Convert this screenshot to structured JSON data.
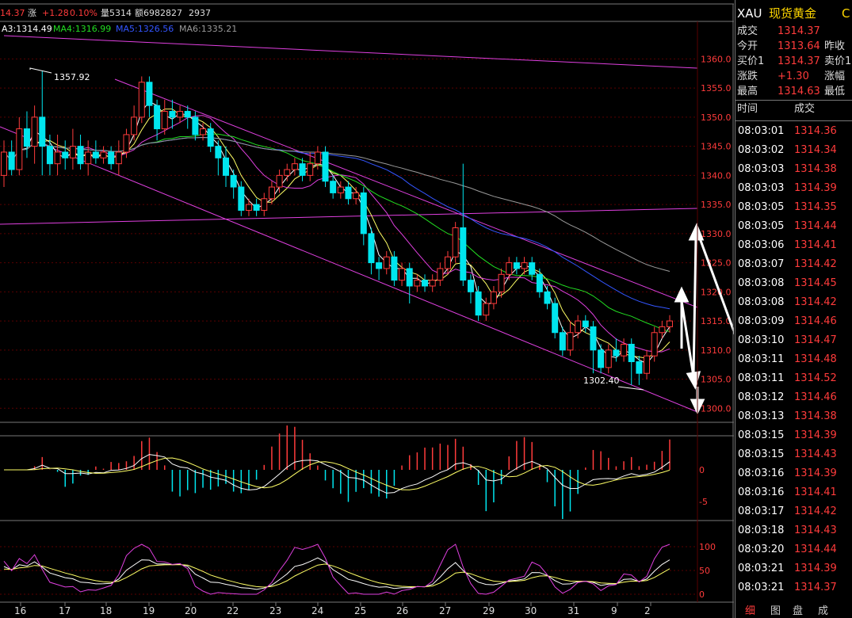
{
  "header": {
    "price": "14.37",
    "change_label": "涨",
    "change": "+1.28",
    "change_pct": "0.10%",
    "volume": "量5314",
    "amount": "额6982827",
    "extra": "2937"
  },
  "ma_legend": [
    {
      "label": "A3:1314.49",
      "color": "#ffffff"
    },
    {
      "label": "MA4:1316.99",
      "color": "#22dd22"
    },
    {
      "label": "MA5:1326.56",
      "color": "#3355ff"
    },
    {
      "label": "MA6:1335.21",
      "color": "#9a9a9a"
    }
  ],
  "annotations": {
    "high_label": "1357.92",
    "low_label": "1302.40"
  },
  "chart_data": {
    "type": "candlestick",
    "price_axis": {
      "ticks": [
        1360,
        1355,
        1350,
        1345,
        1340,
        1335,
        1330,
        1325,
        1320,
        1315,
        1310,
        1305,
        1300
      ],
      "labels": [
        "1360.0",
        "1355.0",
        "1350.0",
        "1345.0",
        "1340.0",
        "1335.0",
        "1330.0",
        "1325.0",
        "1320.0",
        "1315.0",
        "1310.0",
        "1305.0",
        "1300.0"
      ],
      "range": [
        1298,
        1364
      ]
    },
    "x_labels": [
      "16",
      "17",
      "18",
      "19",
      "20",
      "22",
      "23",
      "24",
      "25",
      "26",
      "27",
      "29",
      "30",
      "31",
      "9",
      "2"
    ],
    "candles": [
      [
        1340,
        1344,
        1338,
        1346
      ],
      [
        1344,
        1341,
        1340,
        1346
      ],
      [
        1341,
        1348,
        1340,
        1350
      ],
      [
        1348,
        1345,
        1343,
        1351
      ],
      [
        1345,
        1350,
        1342,
        1352
      ],
      [
        1350,
        1345,
        1340,
        1358
      ],
      [
        1345,
        1342,
        1340,
        1347
      ],
      [
        1342,
        1344,
        1340,
        1347
      ],
      [
        1344,
        1343,
        1341,
        1346
      ],
      [
        1343,
        1345,
        1341,
        1348
      ],
      [
        1345,
        1342,
        1341,
        1347
      ],
      [
        1342,
        1344,
        1340,
        1346
      ],
      [
        1344,
        1343,
        1342,
        1346
      ],
      [
        1343,
        1344,
        1342,
        1345
      ],
      [
        1344,
        1342,
        1341,
        1345
      ],
      [
        1342,
        1344,
        1340,
        1346
      ],
      [
        1344,
        1347,
        1343,
        1348
      ],
      [
        1347,
        1350,
        1346,
        1352
      ],
      [
        1350,
        1356,
        1349,
        1357
      ],
      [
        1356,
        1352,
        1350,
        1357
      ],
      [
        1352,
        1348,
        1346,
        1353
      ],
      [
        1348,
        1351,
        1347,
        1353
      ],
      [
        1351,
        1350,
        1348,
        1353
      ],
      [
        1350,
        1351,
        1349,
        1352
      ],
      [
        1351,
        1350,
        1348,
        1352
      ],
      [
        1350,
        1347,
        1346,
        1351
      ],
      [
        1347,
        1348,
        1346,
        1349
      ],
      [
        1348,
        1345,
        1344,
        1349
      ],
      [
        1345,
        1343,
        1340,
        1346
      ],
      [
        1343,
        1340,
        1338,
        1345
      ],
      [
        1340,
        1338,
        1336,
        1341
      ],
      [
        1338,
        1334,
        1333,
        1339
      ],
      [
        1334,
        1335,
        1333,
        1336
      ],
      [
        1335,
        1334,
        1333,
        1336
      ],
      [
        1334,
        1336,
        1333,
        1337
      ],
      [
        1336,
        1338,
        1335,
        1339
      ],
      [
        1338,
        1340,
        1337,
        1341
      ],
      [
        1340,
        1341,
        1339,
        1342
      ],
      [
        1341,
        1342,
        1340,
        1343
      ],
      [
        1342,
        1340,
        1339,
        1343
      ],
      [
        1340,
        1342,
        1339,
        1344
      ],
      [
        1342,
        1344,
        1341,
        1345
      ],
      [
        1344,
        1339,
        1338,
        1345
      ],
      [
        1339,
        1337,
        1336,
        1340
      ],
      [
        1337,
        1338,
        1336,
        1339
      ],
      [
        1338,
        1336,
        1335,
        1339
      ],
      [
        1336,
        1337,
        1335,
        1338
      ],
      [
        1337,
        1330,
        1328,
        1338
      ],
      [
        1330,
        1325,
        1323,
        1331
      ],
      [
        1325,
        1324,
        1322,
        1326
      ],
      [
        1324,
        1326,
        1323,
        1327
      ],
      [
        1326,
        1322,
        1321,
        1327
      ],
      [
        1322,
        1324,
        1321,
        1325
      ],
      [
        1324,
        1321,
        1318,
        1325
      ],
      [
        1321,
        1322,
        1320,
        1323
      ],
      [
        1322,
        1321,
        1320,
        1323
      ],
      [
        1321,
        1322,
        1320,
        1323
      ],
      [
        1322,
        1324,
        1321,
        1325
      ],
      [
        1324,
        1326,
        1323,
        1327
      ],
      [
        1326,
        1331,
        1325,
        1332
      ],
      [
        1331,
        1322,
        1321,
        1342
      ],
      [
        1322,
        1320,
        1318,
        1323
      ],
      [
        1320,
        1316,
        1315,
        1321
      ],
      [
        1316,
        1318,
        1315,
        1319
      ],
      [
        1318,
        1320,
        1317,
        1321
      ],
      [
        1320,
        1323,
        1319,
        1324
      ],
      [
        1323,
        1325,
        1322,
        1326
      ],
      [
        1325,
        1324,
        1323,
        1326
      ],
      [
        1324,
        1325,
        1323,
        1326
      ],
      [
        1325,
        1323,
        1322,
        1326
      ],
      [
        1323,
        1320,
        1319,
        1324
      ],
      [
        1320,
        1318,
        1317,
        1321
      ],
      [
        1318,
        1313,
        1312,
        1319
      ],
      [
        1313,
        1310,
        1309,
        1314
      ],
      [
        1310,
        1313,
        1309,
        1315
      ],
      [
        1313,
        1315,
        1312,
        1316
      ],
      [
        1315,
        1314,
        1313,
        1316
      ],
      [
        1314,
        1310,
        1306,
        1315
      ],
      [
        1310,
        1307,
        1306,
        1311
      ],
      [
        1307,
        1310,
        1306,
        1311
      ],
      [
        1310,
        1309,
        1308,
        1312
      ],
      [
        1309,
        1311,
        1308,
        1312
      ],
      [
        1311,
        1308,
        1304,
        1312
      ],
      [
        1308,
        1306,
        1304,
        1309
      ],
      [
        1306,
        1309,
        1305,
        1310
      ],
      [
        1309,
        1313,
        1308,
        1314
      ],
      [
        1313,
        1314,
        1312,
        1315
      ],
      [
        1314,
        1315,
        1313,
        1316
      ]
    ],
    "candle_format": [
      "open",
      "close",
      "low",
      "high"
    ],
    "macd_axis": {
      "ticks": [
        0,
        -5
      ],
      "labels": [
        "0",
        "-5"
      ]
    },
    "kdj_axis": {
      "ticks": [
        100,
        50,
        0
      ],
      "labels": [
        "100",
        "50",
        "0"
      ]
    }
  },
  "side": {
    "symbol": "XAU",
    "name": "现货黄金",
    "suffix": "C",
    "quote": [
      {
        "label": "成交",
        "value": "1314.37",
        "label2": ""
      },
      {
        "label": "今开",
        "value": "1313.64",
        "label2": "昨收"
      },
      {
        "label": "买价1",
        "value": "1314.37",
        "label2": "卖价1"
      },
      {
        "label": "涨跌",
        "value": "+1.30",
        "label2": "涨幅"
      },
      {
        "label": "最高",
        "value": "1314.63",
        "label2": "最低"
      }
    ],
    "ticks_header": {
      "time": "时间",
      "price": "成交"
    },
    "ticks": [
      {
        "time": "08:03:01",
        "price": "1314.36"
      },
      {
        "time": "08:03:02",
        "price": "1314.34"
      },
      {
        "time": "08:03:03",
        "price": "1314.38"
      },
      {
        "time": "08:03:03",
        "price": "1314.39"
      },
      {
        "time": "08:03:05",
        "price": "1314.35"
      },
      {
        "time": "08:03:05",
        "price": "1314.44"
      },
      {
        "time": "08:03:06",
        "price": "1314.41"
      },
      {
        "time": "08:03:07",
        "price": "1314.42"
      },
      {
        "time": "08:03:08",
        "price": "1314.45"
      },
      {
        "time": "08:03:08",
        "price": "1314.42"
      },
      {
        "time": "08:03:09",
        "price": "1314.46"
      },
      {
        "time": "08:03:10",
        "price": "1314.47"
      },
      {
        "time": "08:03:11",
        "price": "1314.48"
      },
      {
        "time": "08:03:11",
        "price": "1314.52"
      },
      {
        "time": "08:03:12",
        "price": "1314.46"
      },
      {
        "time": "08:03:13",
        "price": "1314.38"
      },
      {
        "time": "08:03:15",
        "price": "1314.39"
      },
      {
        "time": "08:03:15",
        "price": "1314.43"
      },
      {
        "time": "08:03:16",
        "price": "1314.39"
      },
      {
        "time": "08:03:16",
        "price": "1314.41"
      },
      {
        "time": "08:03:17",
        "price": "1314.42"
      },
      {
        "time": "08:03:18",
        "price": "1314.43"
      },
      {
        "time": "08:03:20",
        "price": "1314.44"
      },
      {
        "time": "08:03:21",
        "price": "1314.39"
      },
      {
        "time": "08:03:21",
        "price": "1314.37"
      }
    ],
    "tabs": [
      "细",
      "图",
      "盘",
      "成"
    ]
  },
  "colors": {
    "up": "#ff3b3b",
    "down": "#00e5ee",
    "grid": "#5a0000",
    "channel": "#e040e0"
  }
}
